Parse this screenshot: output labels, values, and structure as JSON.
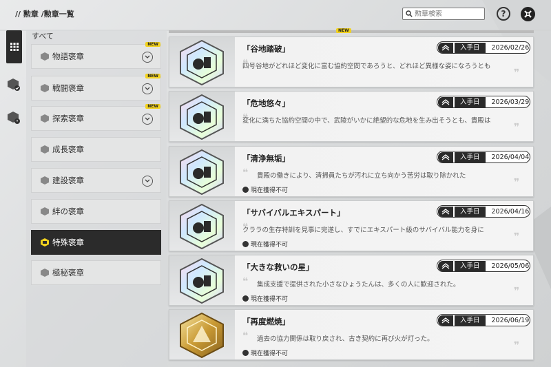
{
  "breadcrumb": "// 勲章 /勲章一覧",
  "search": {
    "placeholder": "勲章検索"
  },
  "help_label": "?",
  "category_header": "すべて",
  "new_tag": "NEW",
  "categories": [
    {
      "label": "物語褒章",
      "new": true,
      "expandable": true,
      "active": false
    },
    {
      "label": "戦闘褒章",
      "new": true,
      "expandable": true,
      "active": false
    },
    {
      "label": "探索褒章",
      "new": true,
      "expandable": true,
      "active": false
    },
    {
      "label": "成長褒章",
      "new": false,
      "expandable": false,
      "active": false
    },
    {
      "label": "建設褒章",
      "new": false,
      "expandable": true,
      "active": false
    },
    {
      "label": "絆の褒章",
      "new": false,
      "expandable": false,
      "active": false
    },
    {
      "label": "特殊褒章",
      "new": false,
      "expandable": false,
      "active": true
    },
    {
      "label": "極秘褒章",
      "new": false,
      "expandable": false,
      "active": false
    }
  ],
  "obtained_label": "入手日",
  "status_label": "現在獲得不可",
  "cards": [
    {
      "title": "「谷地踏破」",
      "date": "2026/02/26",
      "desc": "四号谷地がどれほど変化に富む協約空間であろうと、どれほど異様な姿になろうとも",
      "status": false,
      "medal": "holo",
      "indent": false
    },
    {
      "title": "「危地悠々」",
      "date": "2026/03/29",
      "desc": "変化に満ちた協約空間の中で、武陵がいかに絶望的な危地を生み出そうとも、貴殿は",
      "status": false,
      "medal": "holo",
      "indent": false
    },
    {
      "title": "「清浄無垢」",
      "date": "2026/04/04",
      "desc": "貴殿の働きにより、清掃員たちが汚れに立ち向かう苦労は取り除かれた",
      "status": true,
      "medal": "holo",
      "indent": true
    },
    {
      "title": "「サバイバルエキスパート」",
      "date": "2026/04/16",
      "desc": "クララの生存特訓を見事に完遂し、すでにエキスパート級のサバイバル能力を身に",
      "status": true,
      "medal": "holo",
      "indent": false
    },
    {
      "title": "「大きな救いの星」",
      "date": "2026/05/06",
      "desc": "集成支援で提供された小さなひょうたんは、多くの人に歓迎された。",
      "status": true,
      "medal": "holo",
      "indent": true
    },
    {
      "title": "「再度燃焼」",
      "date": "2026/06/19",
      "desc": "過去の協力関係は取り戻され、古き契約に再び火が灯った。",
      "status": true,
      "medal": "gold",
      "indent": true
    }
  ],
  "colors": {
    "active_bg": "#2b2b2b",
    "new_tag": "#f2d21f",
    "card_bg": "#f4f4f4"
  }
}
